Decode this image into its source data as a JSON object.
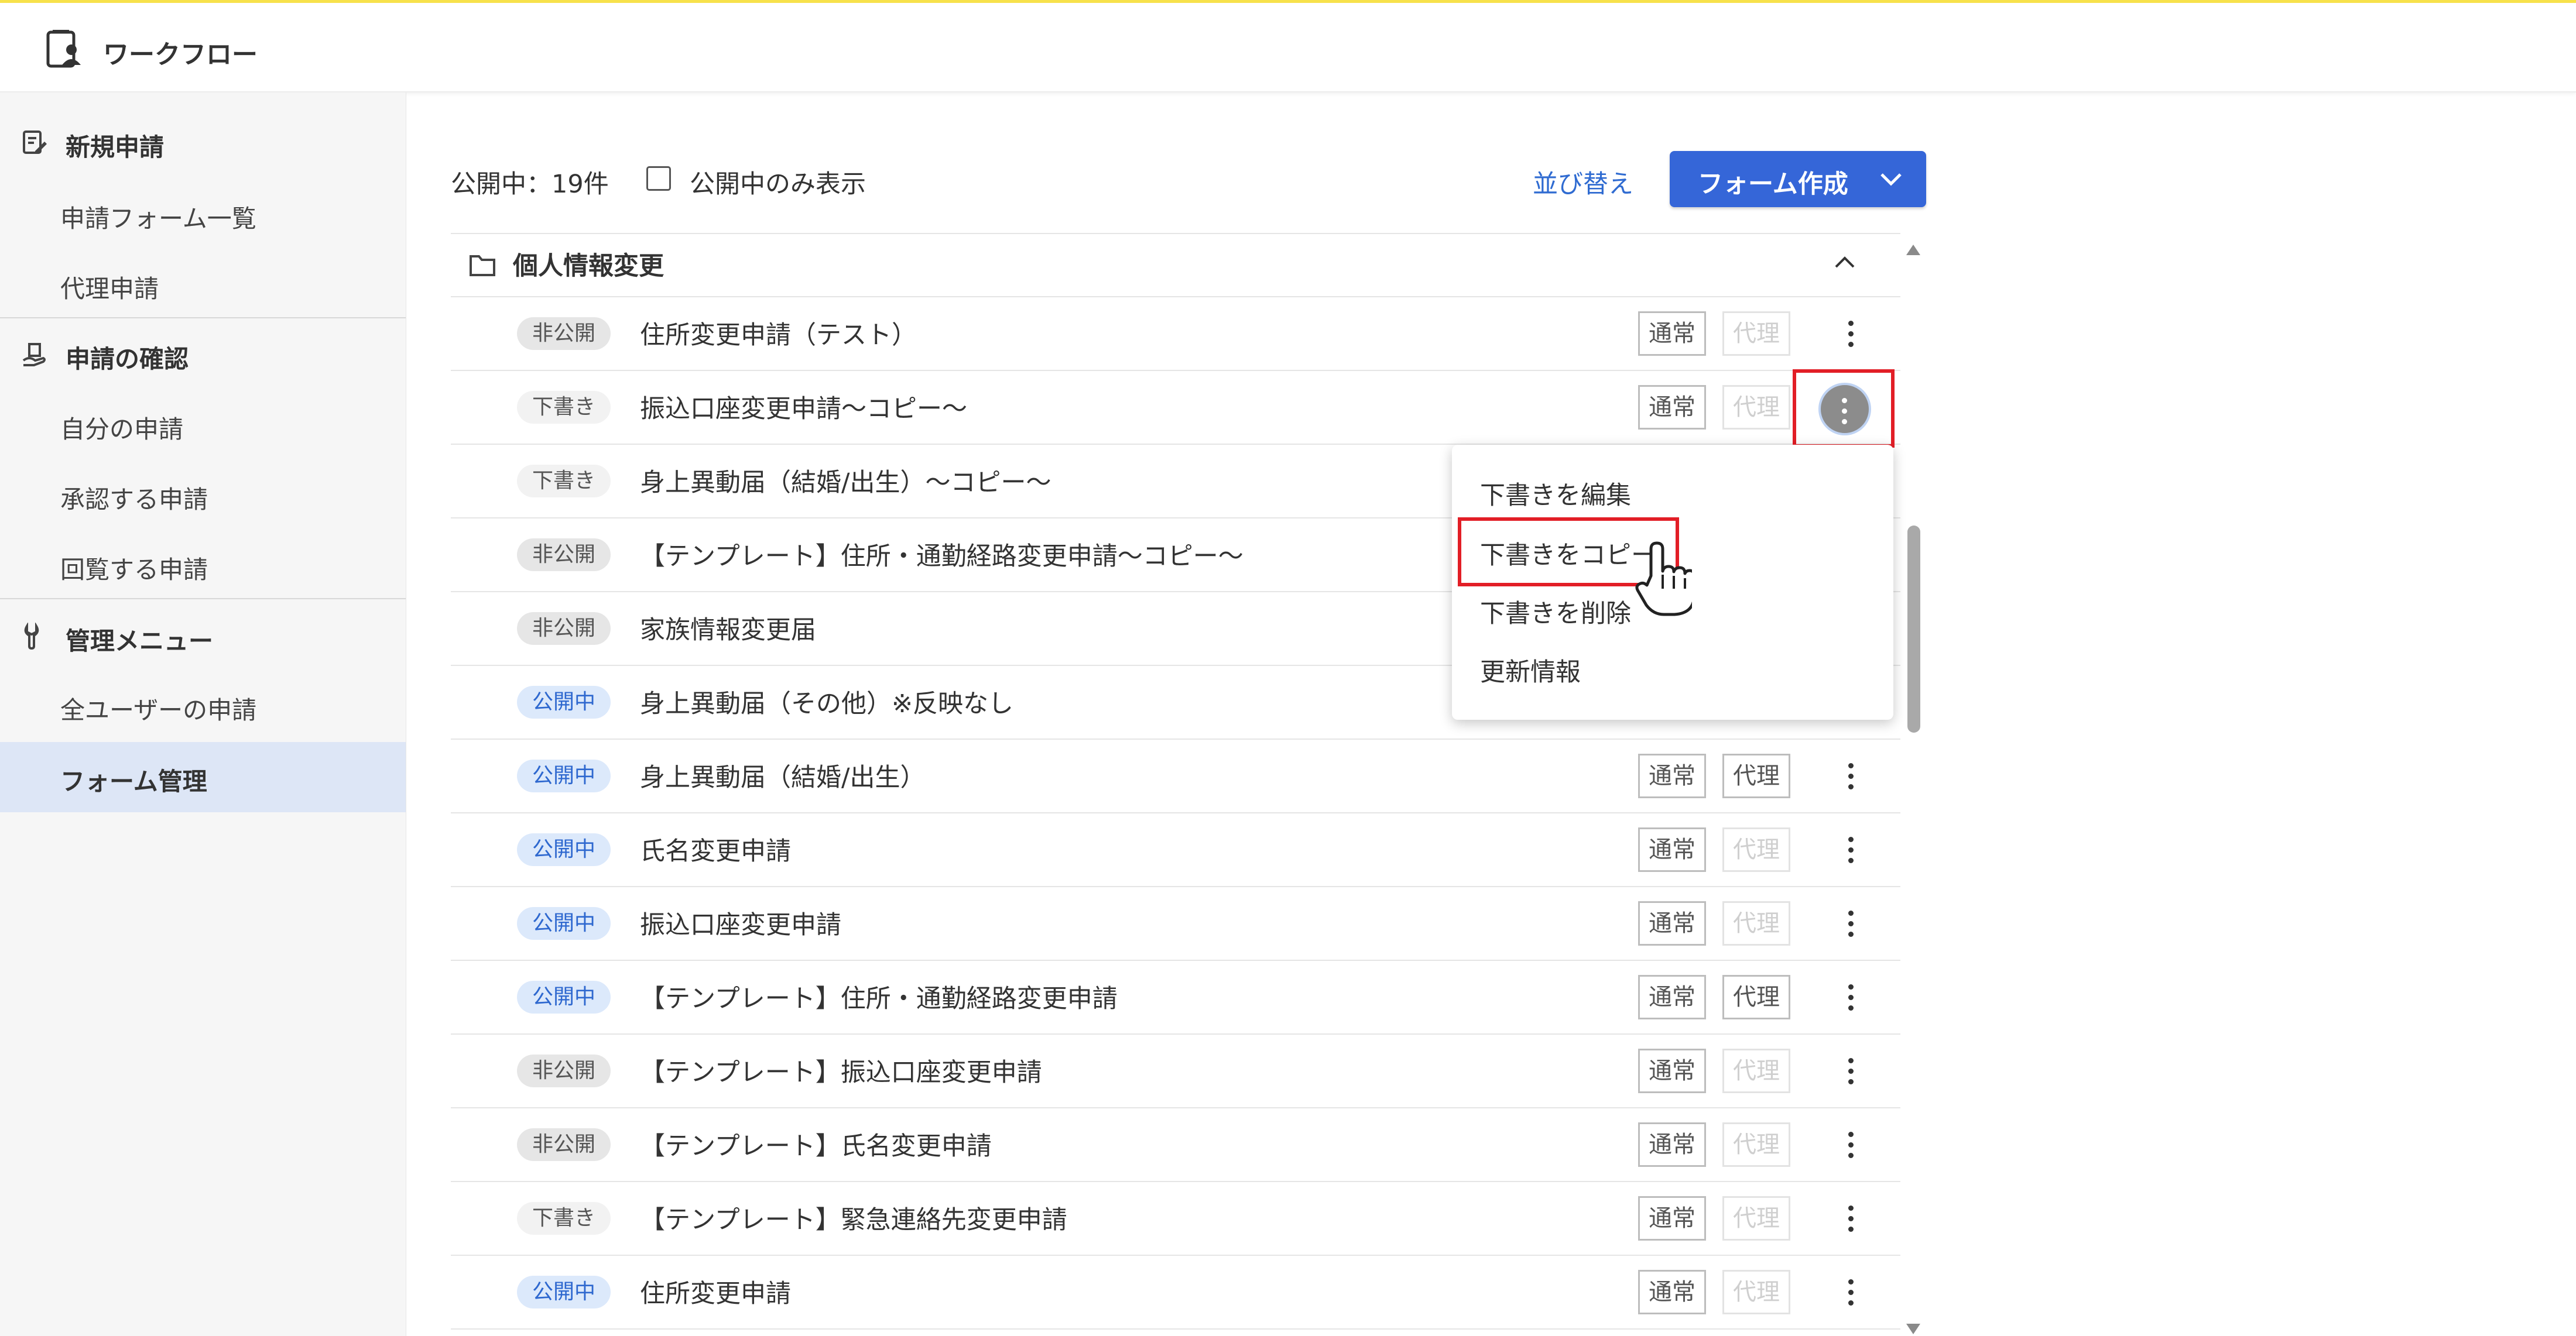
{
  "app": {
    "title": "ワークフロー"
  },
  "sidebar": {
    "sections": [
      {
        "label": "新規申請",
        "items": [
          "申請フォーム一覧",
          "代理申請"
        ]
      },
      {
        "label": "申請の確認",
        "items": [
          "自分の申請",
          "承認する申請",
          "回覧する申請"
        ]
      },
      {
        "label": "管理メニュー",
        "items": [
          "全ユーザーの申請",
          "フォーム管理"
        ]
      }
    ],
    "active_item": "フォーム管理"
  },
  "toolbar": {
    "count_text": "公開中：19件",
    "filter_label": "公開中のみ表示",
    "filter_checked": false,
    "sort_label": "並び替え",
    "create_label": "フォーム作成"
  },
  "folder": {
    "name": "個人情報変更",
    "expanded": true
  },
  "forms": [
    {
      "status": "非公開",
      "title": "住所変更申請（テスト）",
      "normal": "通常",
      "proxy": "代理",
      "proxy_enabled": false
    },
    {
      "status": "下書き",
      "title": "振込口座変更申請～コピー～",
      "normal": "通常",
      "proxy": "代理",
      "proxy_enabled": false
    },
    {
      "status": "下書き",
      "title": "身上異動届（結婚/出生）～コピー～"
    },
    {
      "status": "非公開",
      "title": "【テンプレート】住所・通勤経路変更申請～コピー～"
    },
    {
      "status": "非公開",
      "title": "家族情報変更届"
    },
    {
      "status": "公開中",
      "title": "身上異動届（その他）※反映なし"
    },
    {
      "status": "公開中",
      "title": "身上異動届（結婚/出生）",
      "normal": "通常",
      "proxy": "代理",
      "proxy_enabled": true
    },
    {
      "status": "公開中",
      "title": "氏名変更申請",
      "normal": "通常",
      "proxy": "代理",
      "proxy_enabled": false
    },
    {
      "status": "公開中",
      "title": "振込口座変更申請",
      "normal": "通常",
      "proxy": "代理",
      "proxy_enabled": false
    },
    {
      "status": "公開中",
      "title": "【テンプレート】住所・通勤経路変更申請",
      "normal": "通常",
      "proxy": "代理",
      "proxy_enabled": true
    },
    {
      "status": "非公開",
      "title": "【テンプレート】振込口座変更申請",
      "normal": "通常",
      "proxy": "代理",
      "proxy_enabled": false
    },
    {
      "status": "非公開",
      "title": "【テンプレート】氏名変更申請",
      "normal": "通常",
      "proxy": "代理",
      "proxy_enabled": false
    },
    {
      "status": "下書き",
      "title": "【テンプレート】緊急連絡先変更申請",
      "normal": "通常",
      "proxy": "代理",
      "proxy_enabled": false
    },
    {
      "status": "公開中",
      "title": "住所変更申請",
      "normal": "通常",
      "proxy": "代理",
      "proxy_enabled": false
    }
  ],
  "context_menu": {
    "items": [
      "下書きを編集",
      "下書きをコピー",
      "下書きを削除",
      "更新情報"
    ],
    "highlighted": "下書きをコピー"
  },
  "colors": {
    "accent": "#3566d8",
    "highlight": "#e21e26",
    "top_border": "#f7e14b",
    "active_nav": "#dde6f6"
  }
}
